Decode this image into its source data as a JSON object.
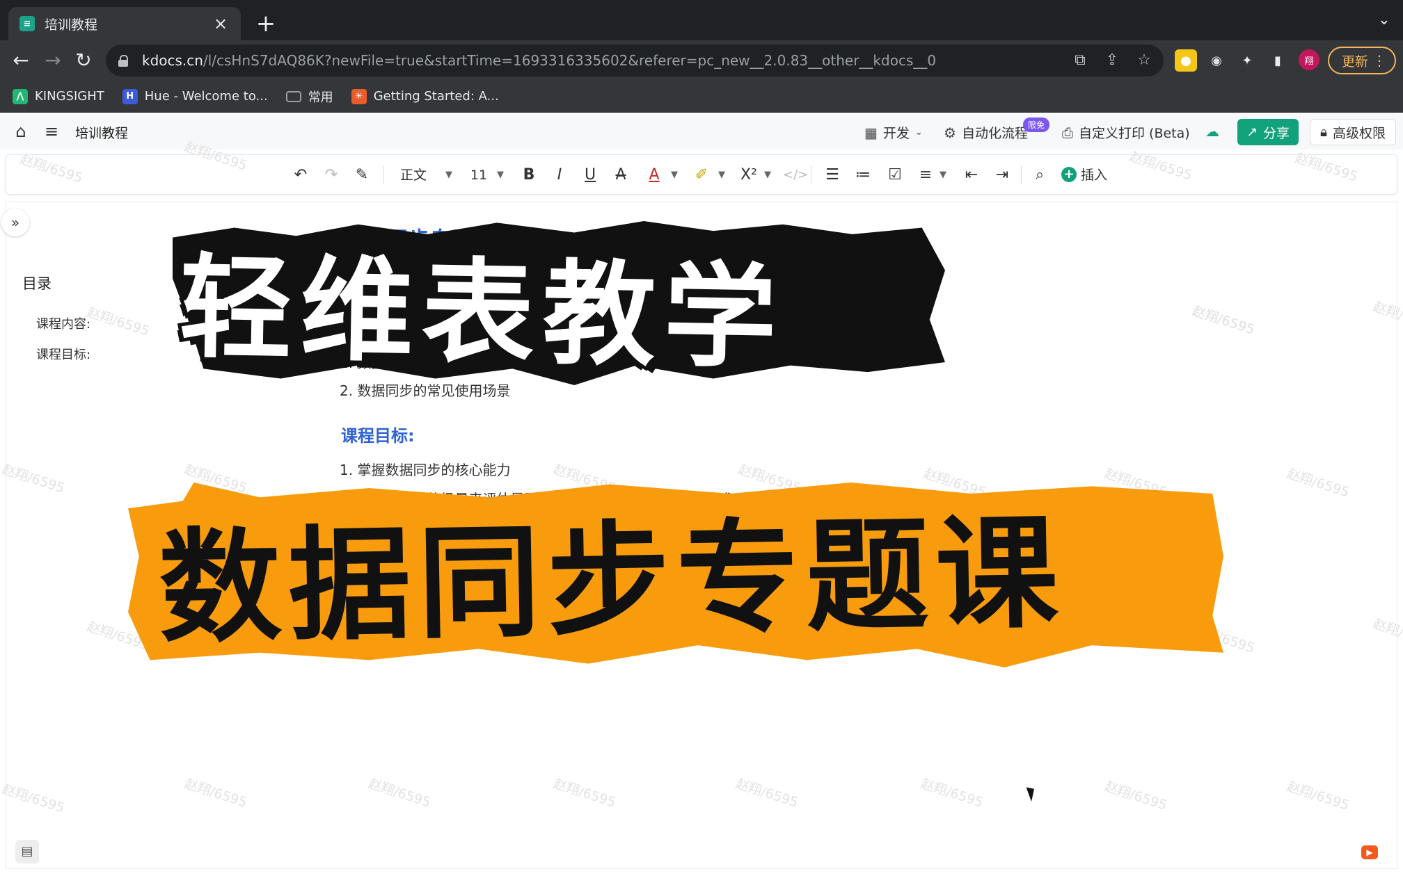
{
  "browser": {
    "tab": {
      "title": "培训教程",
      "favicon_icon": "kdocs-favicon-icon"
    },
    "address": {
      "host": "kdocs.cn",
      "path": "/l/csHnS7dAQ86K?newFile=true&startTime=1693316335602&referer=pc_new__2.0.83__other__kdocs__0"
    },
    "update_label": "更新",
    "profile_initial": "翔"
  },
  "bookmarks": [
    {
      "label": "KINGSIGHT",
      "icon": "kingsight-icon",
      "color": "#22b573"
    },
    {
      "label": "Hue - Welcome to...",
      "icon": "hue-icon",
      "color": "#3b5bdb"
    },
    {
      "label": "常用",
      "icon": "folder-icon",
      "color": "#9aa0a6"
    },
    {
      "label": "Getting Started: A...",
      "icon": "airflow-icon",
      "color": "#e85d2a"
    }
  ],
  "app_header": {
    "doc_title": "培训教程",
    "dev_label": "开发",
    "automation_label": "自动化流程",
    "automation_badge": "限免",
    "print_label": "自定义打印 (Beta)",
    "share_label": "分享",
    "permission_label": "高级权限",
    "share_color": "#11a17b"
  },
  "format_toolbar": {
    "style_label": "正文",
    "font_size": "11",
    "insert_label": "插入"
  },
  "toc": {
    "title": "目录",
    "items": [
      "课程内容:",
      "课程目标:"
    ]
  },
  "document": {
    "heading": "数据同步专题课程",
    "content_item_1": "1. 数据同步功能介绍",
    "content_item_2": "2.  数据同步的常见使用场景",
    "goals_heading": "课程目标:",
    "goal_1": "1.  掌握数据同步的核心能力",
    "goal_2": "2.  能根据用户的场景来评估是否可以使用数据同步满足业务需求",
    "watermark": "赵翔/6595",
    "heading_color": "#2e63d3"
  },
  "overlay": {
    "title_line_1": "轻维表教学",
    "title_line_2": "数据同步专题课",
    "accent_color": "#f89c0e"
  }
}
